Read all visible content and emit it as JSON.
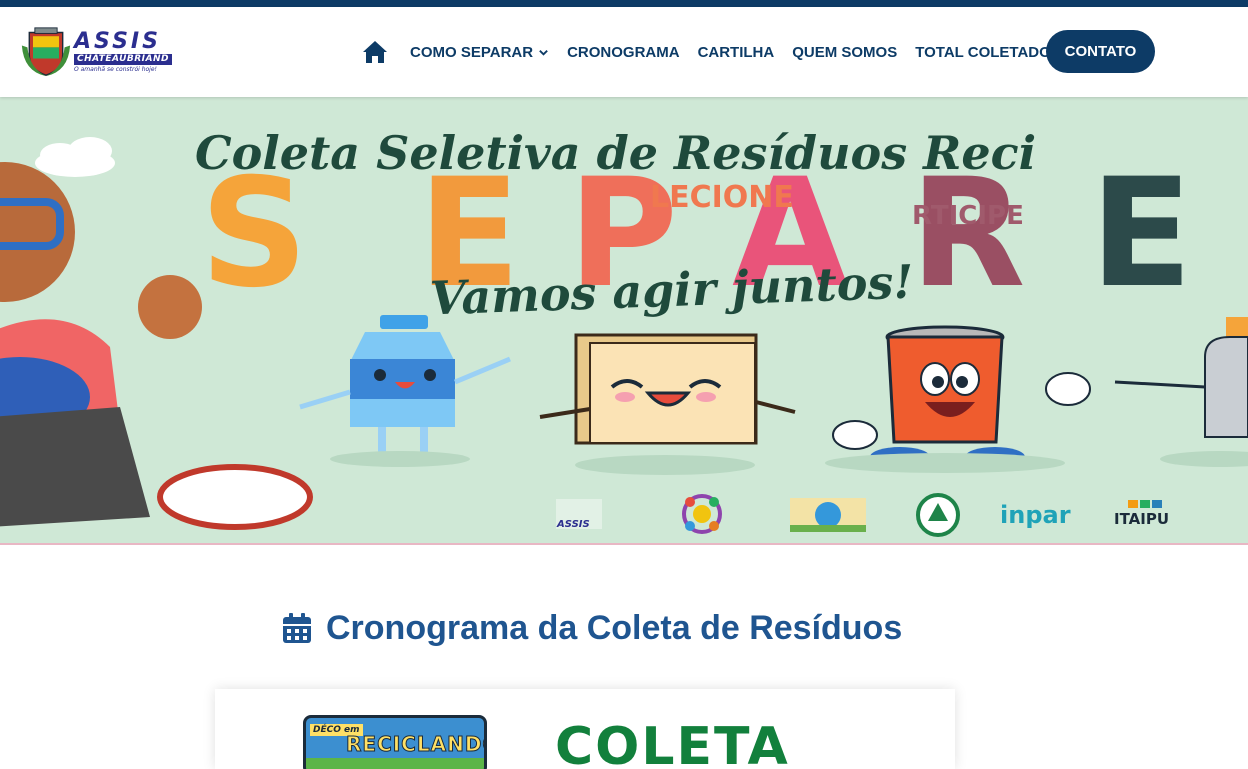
{
  "colors": {
    "brand_navy": "#0d3b66",
    "title_blue": "#1f5590",
    "banner_bg": "#cfe8d6",
    "coleta_green": "#12803c"
  },
  "logo": {
    "line1": "ASSIS",
    "line2": "CHATEAUBRIAND",
    "tagline": "O amanhã se constrói hoje!",
    "icon": "city-crest-icon"
  },
  "nav": {
    "home_icon": "home-icon",
    "items": [
      {
        "label": "COMO SEPARAR",
        "has_dropdown": true
      },
      {
        "label": "CRONOGRAMA"
      },
      {
        "label": "CARTILHA"
      },
      {
        "label": "QUEM SOMOS"
      },
      {
        "label": "TOTAL COLETADO"
      }
    ],
    "contact_label": "CONTATO"
  },
  "banner": {
    "headline": "Coleta Seletiva de Resíduos Reci",
    "big_word": "SEPARE",
    "sub_lecione": "LECIONE",
    "sub_rticipe": "RTICIPE",
    "slogan": "Vamos agir juntos!",
    "partner_logos": [
      "ASSIS",
      "",
      "",
      "",
      "inpar",
      "ITAIPU"
    ]
  },
  "section": {
    "icon": "calendar-icon",
    "title": "Cronograma da Coleta de Resíduos"
  },
  "card": {
    "thumb_tag": "DÉCO em",
    "thumb_title": "RECICLANDO",
    "headline": "COLETA"
  }
}
